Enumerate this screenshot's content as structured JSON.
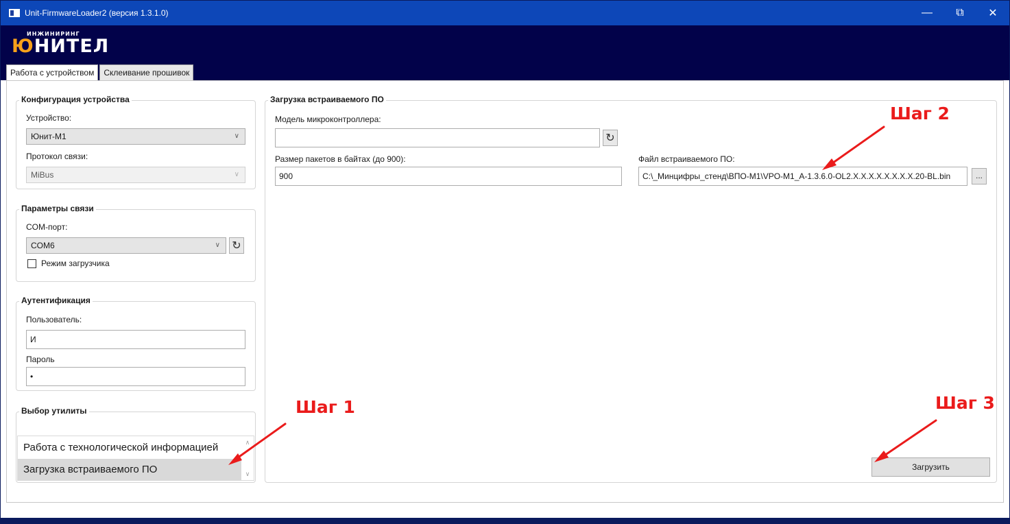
{
  "window": {
    "title": "Unit-FirmwareLoader2 (версия 1.3.1.0)"
  },
  "logo": {
    "small": "ИНЖИНИРИНГ",
    "first_letter": "Ю",
    "rest": "НИТЕЛ"
  },
  "tabs": [
    {
      "label": "Работа с устройством"
    },
    {
      "label": "Склеивание прошивок"
    }
  ],
  "device_config": {
    "title": "Конфигурация устройства",
    "device_label": "Устройство:",
    "device_value": "Юнит-М1",
    "protocol_label": "Протокол связи:",
    "protocol_value": "MiBus"
  },
  "connection": {
    "title": "Параметры связи",
    "port_label": "COM-порт:",
    "port_value": "COM6",
    "bootloader_label": "Режим загрузчика",
    "bootloader_checked": false
  },
  "auth": {
    "title": "Аутентификация",
    "user_label": "Пользователь:",
    "user_value": "И",
    "password_label": "Пароль",
    "password_value": "•"
  },
  "utility": {
    "title": "Выбор утилиты",
    "items": [
      {
        "label": "Работа с технологической информацией"
      },
      {
        "label": "Загрузка встраиваемого ПО"
      }
    ],
    "selected_index": 1
  },
  "firmware": {
    "title": "Загрузка встраиваемого ПО",
    "mcu_label": "Модель микроконтроллера:",
    "mcu_value": "",
    "packet_label": "Размер пакетов в байтах (до 900):",
    "packet_value": "900",
    "file_label": "Файл встраиваемого ПО:",
    "file_value": "C:\\_Минцифры_стенд\\ВПО-М1\\VPO-M1_A-1.3.6.0-OL2.X.X.X.X.X.X.X.X.20-BL.bin",
    "browse_label": "...",
    "upload_label": "Загрузить"
  },
  "annotations": {
    "step1": "Шаг 1",
    "step2": "Шаг 2",
    "step3": "Шаг 3"
  },
  "colors": {
    "titlebar": "#0d47b8",
    "header": "#02024a",
    "logo_accent": "#f7a11a",
    "annotation": "#ea1b1b"
  },
  "icons": {
    "refresh": "refresh-icon",
    "chevron": "chevron-down-icon"
  }
}
